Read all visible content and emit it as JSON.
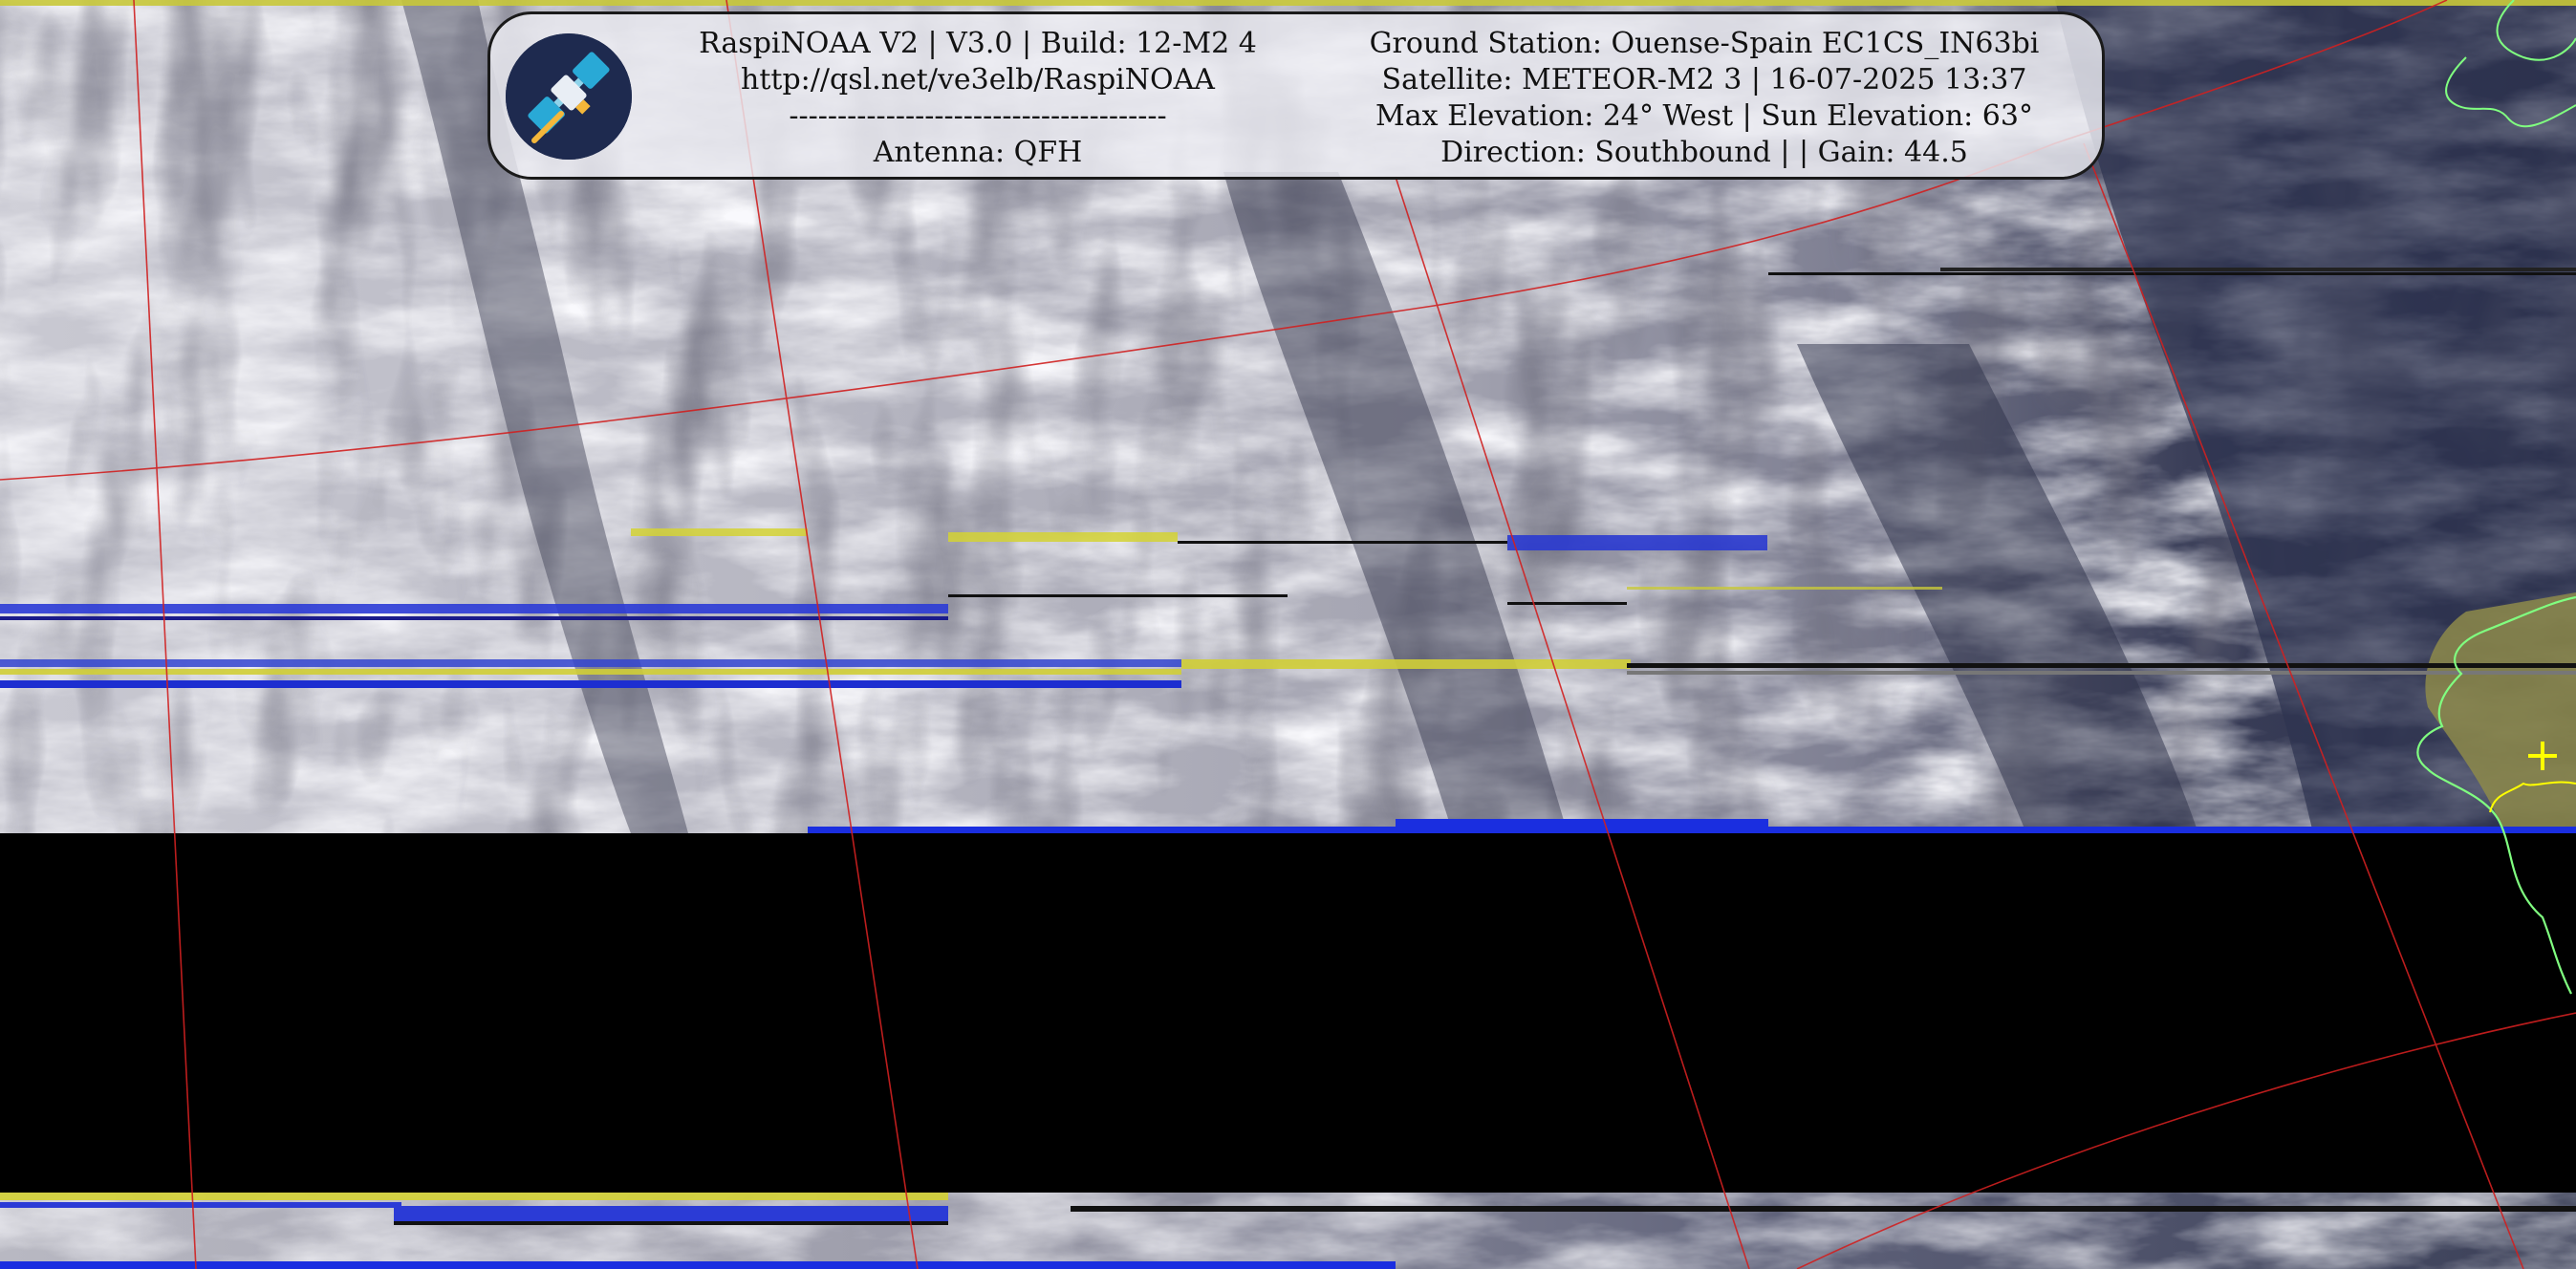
{
  "header": {
    "left": {
      "line1": "RaspiNOAA V2 | V3.0 | Build: 12-M2 4",
      "line2": "http://qsl.net/ve3elb/RaspiNOAA",
      "line3": "---------------------------------------",
      "line4": "Antenna: QFH"
    },
    "right": {
      "line1": "Ground Station: Ouense-Spain EC1CS_IN63bi",
      "line2": "Satellite: METEOR-M2 3 | 16-07-2025 13:37",
      "line3": "Max Elevation: 24° West | Sun Elevation: 63°",
      "line4": "Direction: Southbound | | Gain: 44.5"
    }
  },
  "icons": {
    "logo": "satellite-icon",
    "marker": "crosshair-icon"
  },
  "colors": {
    "grid": "#d02020",
    "coastline": "#80ff80",
    "border": "#ffff00",
    "marker": "#ffff00",
    "panel_border": "#1a1a1a"
  }
}
